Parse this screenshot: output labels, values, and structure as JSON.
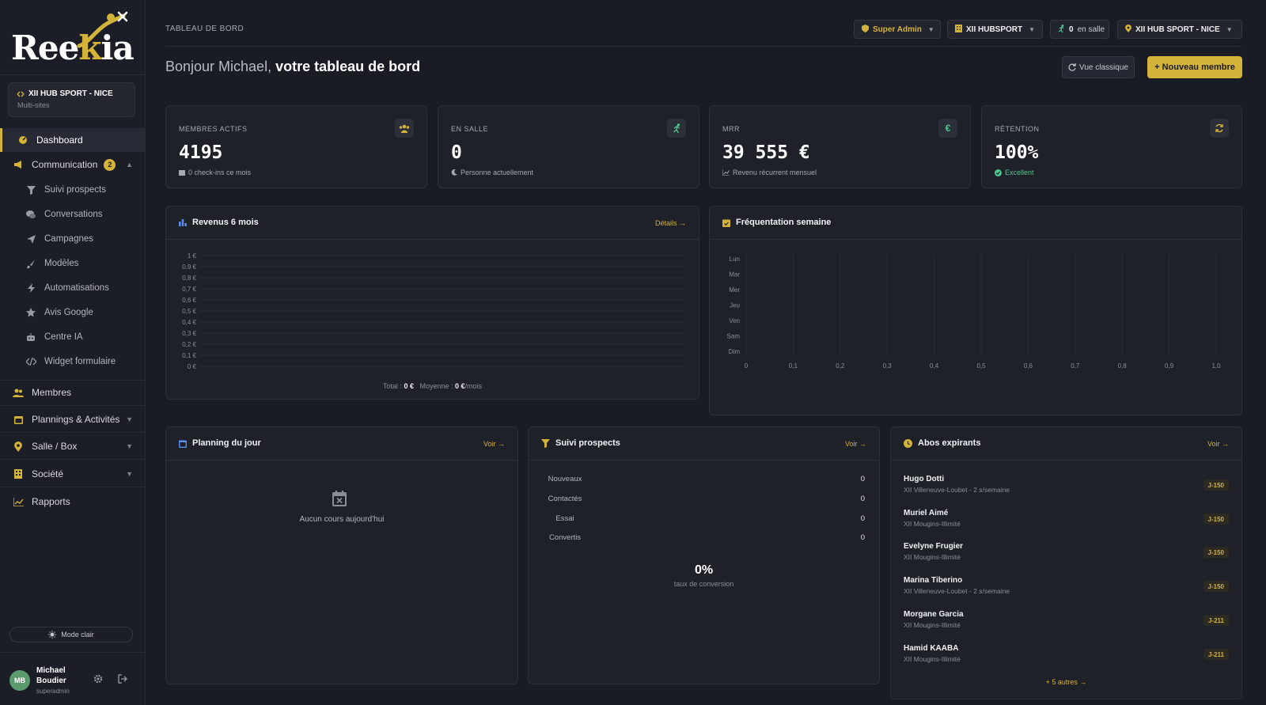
{
  "app": {
    "logo_main": "Reekia",
    "site_name": "XII HUB SPORT - NICE",
    "site_sub": "Multi-sites",
    "mode_label": "Mode clair"
  },
  "nav": {
    "dashboard": "Dashboard",
    "communication": "Communication",
    "communication_badge": "2",
    "sub": [
      "Suivi prospects",
      "Conversations",
      "Campagnes",
      "Modèles",
      "Automatisations",
      "Avis Google",
      "Centre IA",
      "Widget formulaire"
    ],
    "membres": "Membres",
    "plannings": "Plannings & Activités",
    "salle": "Salle / Box",
    "societe": "Société",
    "rapports": "Rapports"
  },
  "user": {
    "initials": "MB",
    "name": "Michael Boudier",
    "role": "superadmin"
  },
  "header": {
    "breadcrumb": "TABLEAU DE BORD",
    "role_pill": "Super Admin",
    "org_pill": "XII HUBSPORT",
    "in_gym_count": "0",
    "in_gym_label": "en salle",
    "site_pill": "XII HUB SPORT - NICE",
    "greeting_light": "Bonjour Michael,",
    "greeting_bold": "votre tableau de bord",
    "btn_classic": "Vue classique",
    "btn_new": "+ Nouveau membre"
  },
  "stats": [
    {
      "label": "MEMBRES ACTIFS",
      "value": "4195",
      "note": "0 check-ins ce mois"
    },
    {
      "label": "EN SALLE",
      "value": "0",
      "note": "Personne actuellement"
    },
    {
      "label": "MRR",
      "value": "39 555 €",
      "note": "Revenu récurrent mensuel"
    },
    {
      "label": "RÉTENTION",
      "value": "100%",
      "note": "Excellent"
    }
  ],
  "revenus": {
    "title": "Revenus 6 mois",
    "link": "Détails →",
    "total_label": "Total :",
    "total_value": "0 €",
    "avg_label": "Moyenne :",
    "avg_value": "0 €",
    "avg_unit": "/mois"
  },
  "frequentation": {
    "title": "Fréquentation semaine"
  },
  "chart_data": [
    {
      "type": "bar",
      "title": "Revenus 6 mois",
      "y_ticks": [
        "1 €",
        "0,9 €",
        "0,8 €",
        "0,7 €",
        "0,6 €",
        "0,5 €",
        "0,4 €",
        "0,3 €",
        "0,2 €",
        "0,1 €",
        "0 €"
      ],
      "ylim": [
        0,
        1
      ],
      "grid": true
    },
    {
      "type": "bar",
      "orientation": "horizontal",
      "title": "Fréquentation semaine",
      "categories": [
        "Lun",
        "Mar",
        "Mer",
        "Jeu",
        "Ven",
        "Sam",
        "Dim"
      ],
      "values": [
        0,
        0,
        0,
        0,
        0,
        0,
        0
      ],
      "x_ticks": [
        "0",
        "0,1",
        "0,2",
        "0,3",
        "0,4",
        "0,5",
        "0,6",
        "0,7",
        "0,8",
        "0,9",
        "1,0"
      ],
      "xlim": [
        0,
        1
      ],
      "grid": true
    }
  ],
  "planning": {
    "title": "Planning du jour",
    "link": "Voir →",
    "empty": "Aucun cours aujourd'hui"
  },
  "prospects": {
    "title": "Suivi prospects",
    "link": "Voir →",
    "rows": [
      {
        "label": "Nouveaux",
        "value": "0"
      },
      {
        "label": "Contactés",
        "value": "0"
      },
      {
        "label": "Essai",
        "value": "0"
      },
      {
        "label": "Convertis",
        "value": "0"
      }
    ],
    "pct": "0%",
    "pct_label": "taux de conversion"
  },
  "abos": {
    "title": "Abos expirants",
    "link": "Voir →",
    "rows": [
      {
        "name": "Hugo Dotti",
        "sub": "XII Villeneuve-Loubet - 2 s/semaine",
        "tag": "J-150"
      },
      {
        "name": "Muriel Aimé",
        "sub": "XII Mougins-Illimité",
        "tag": "J-150"
      },
      {
        "name": "Evelyne Frugier",
        "sub": "XII Mougins-Illimité",
        "tag": "J-150"
      },
      {
        "name": "Marina Tiberino",
        "sub": "XII Villeneuve-Loubet - 2 s/semaine",
        "tag": "J-150"
      },
      {
        "name": "Morgane Garcia",
        "sub": "XII Mougins-Illimité",
        "tag": "J-211"
      },
      {
        "name": "Hamid KAABA",
        "sub": "XII Mougins-Illimité",
        "tag": "J-211"
      }
    ],
    "more": "+ 5 autres →"
  }
}
